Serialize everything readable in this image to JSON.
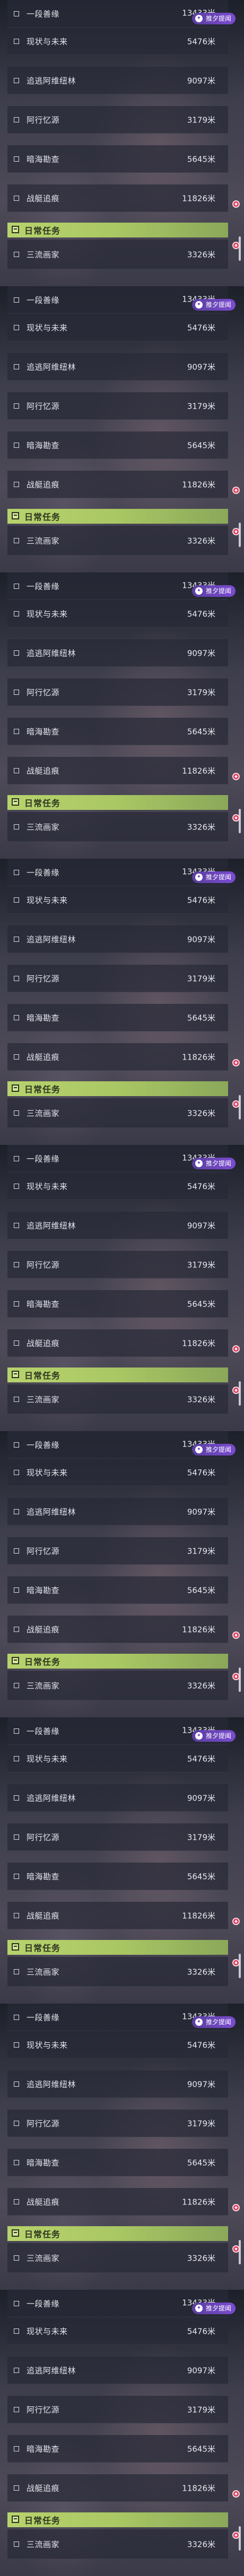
{
  "rows": [
    {
      "name": "一段善缘",
      "value": "13433米"
    },
    {
      "name": "现状与未来",
      "value": "5476米"
    },
    {
      "name": "追逃阿维纽林",
      "value": "9097米"
    },
    {
      "name": "阿行忆源",
      "value": "3179米"
    },
    {
      "name": "暗海勘查",
      "value": "5645米"
    },
    {
      "name": "战艇追痕",
      "value": "11826米"
    }
  ],
  "badge": {
    "label": "推夕提闻",
    "icon": "sparkle-icon"
  },
  "section": {
    "title": "日常任务",
    "icon": "task-icon"
  },
  "daily_row": {
    "name": "三流画家",
    "value": "3326米"
  },
  "colors": {
    "section_bar": "#b7d36d",
    "badge": "#6a46c4",
    "alert": "#e0385a"
  },
  "panel_count": 9
}
